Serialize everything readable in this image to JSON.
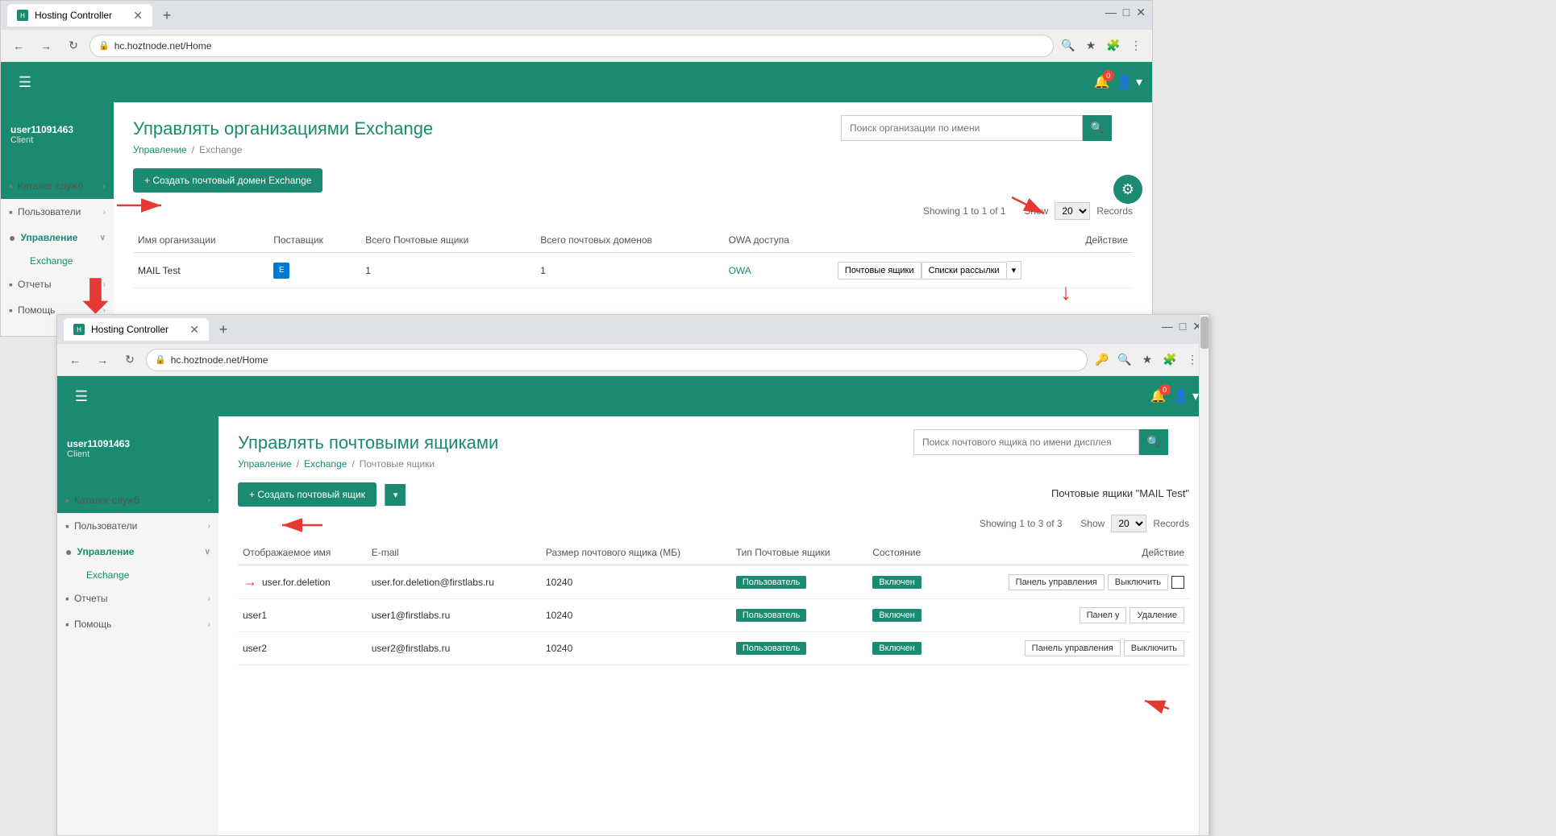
{
  "window1": {
    "tab_icon": "H",
    "tab_title": "Hosting Controller",
    "url": "hc.hoztnode.net/Home",
    "user": {
      "name": "user11091463",
      "role": "Client"
    },
    "topbar": {
      "menu_icon": "☰",
      "bell_icon": "🔔",
      "bell_badge": "0",
      "user_icon": "👤"
    },
    "sidebar": {
      "items": [
        {
          "label": "Каталог служб",
          "icon": "▪",
          "has_arrow": true
        },
        {
          "label": "Пользователи",
          "icon": "▪",
          "has_arrow": true
        },
        {
          "label": "Управление",
          "icon": "▪",
          "has_arrow": true,
          "active": true
        },
        {
          "label": "Отчеты",
          "icon": "▪",
          "has_arrow": true
        },
        {
          "label": "Помощь",
          "icon": "▪",
          "has_arrow": true
        }
      ],
      "sub_items": [
        "Exchange"
      ]
    },
    "page": {
      "title_prefix": "Управлять организациями",
      "title_accent": "Exchange",
      "breadcrumb": [
        "Управление",
        "/",
        "Exchange"
      ],
      "search_placeholder": "Поиск организации по имени",
      "create_btn": "+ Создать почтовый домен Exchange",
      "showing_text": "Showing 1 to 1 of 1",
      "show_label": "Show",
      "show_count": "20",
      "records_label": "Records",
      "table": {
        "headers": [
          "Имя организации",
          "Поставщик",
          "Всего Почтовые ящики",
          "Всего почтовых доменов",
          "OWA доступа",
          "Действие"
        ],
        "rows": [
          {
            "name": "MAIL Test",
            "provider_icon": "E",
            "total_mailboxes": "1",
            "total_domains": "1",
            "owa": "OWA",
            "action1": "Почтовые ящики",
            "action2": "Списки рассылки"
          }
        ]
      }
    }
  },
  "window2": {
    "tab_icon": "H",
    "tab_title": "Hosting Controller",
    "url": "hc.hoztnode.net/Home",
    "user": {
      "name": "user11091463",
      "role": "Client"
    },
    "sidebar": {
      "items": [
        {
          "label": "Каталог служб",
          "icon": "▪",
          "has_arrow": true
        },
        {
          "label": "Пользователи",
          "icon": "▪",
          "has_arrow": true
        },
        {
          "label": "Управление",
          "icon": "▪",
          "has_arrow": true,
          "active": true
        },
        {
          "label": "Отчеты",
          "icon": "▪",
          "has_arrow": true
        },
        {
          "label": "Помощь",
          "icon": "▪",
          "has_arrow": true
        }
      ],
      "sub_items": [
        "Exchange"
      ]
    },
    "page": {
      "title": "Управлять почтовыми ящиками",
      "breadcrumb": [
        "Управление",
        "/",
        "Exchange",
        "/",
        "Почтовые ящики"
      ],
      "search_placeholder": "Поиск почтового ящика по имени дисплея",
      "create_btn": "+ Создать почтовый ящик",
      "mailboxes_title": "Почтовые ящики \"MAIL Test\"",
      "showing_text": "Showing 1 to 3 of 3",
      "show_label": "Show",
      "show_count": "20",
      "records_label": "Records",
      "table": {
        "headers": [
          "Отображаемое имя",
          "E-mail",
          "Размер почтового ящика (МБ)",
          "Тип Почтовые ящики",
          "Состояние",
          "Действие"
        ],
        "rows": [
          {
            "name": "user.for.deletion",
            "email": "user.for.deletion@firstlabs.ru",
            "size": "10240",
            "type": "Пользователь",
            "status": "Включен",
            "action_panel": "Панель управления",
            "action_disable": "Выключить",
            "has_checkbox": true,
            "is_highlighted": true
          },
          {
            "name": "user1",
            "email": "user1@firstlabs.ru",
            "size": "10240",
            "type": "Пользователь",
            "status": "Включен",
            "action_panel": "Панел у",
            "action_delete": "Удаление",
            "is_highlighted": false
          },
          {
            "name": "user2",
            "email": "user2@firstlabs.ru",
            "size": "10240",
            "type": "Пользователь",
            "status": "Включен",
            "action_panel": "Панель управления",
            "action_disable": "Выключить",
            "is_highlighted": false
          }
        ]
      }
    }
  }
}
